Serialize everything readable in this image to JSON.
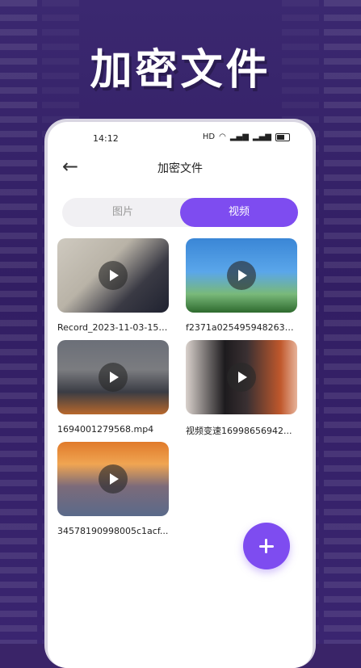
{
  "headline": "加密文件",
  "status_bar": {
    "time": "14:12",
    "icons": [
      "hd-icon",
      "wifi-icon",
      "signal-icon",
      "signal-icon",
      "battery-icon"
    ]
  },
  "nav": {
    "back_icon": "arrow-left-icon",
    "title": "加密文件"
  },
  "tabs": [
    {
      "label": "图片",
      "active": false
    },
    {
      "label": "视频",
      "active": true
    }
  ],
  "videos": [
    {
      "name": "Record_2023-11-03-15-..."
    },
    {
      "name": "f2371a0254959482633..."
    },
    {
      "name": "1694001279568.mp4"
    },
    {
      "name": "视频变速16998656942..."
    },
    {
      "name": "34578190998005c1acf..."
    }
  ],
  "fab": {
    "icon": "plus-icon"
  },
  "colors": {
    "accent": "#7e4cf0",
    "background": "#3a2468"
  }
}
